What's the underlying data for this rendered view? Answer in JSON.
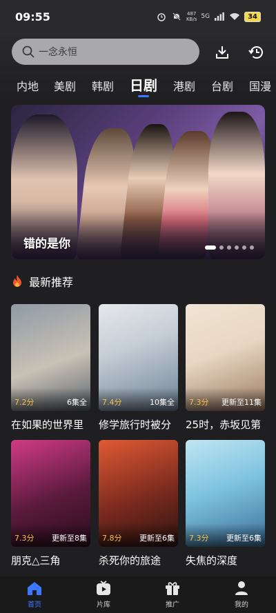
{
  "status": {
    "time": "09:55",
    "net_speed_top": "487",
    "net_speed_bottom": "KB/s",
    "signal": "5G",
    "battery": "34"
  },
  "search": {
    "placeholder": "一念永恒"
  },
  "tabs": [
    {
      "label": "内地"
    },
    {
      "label": "美剧"
    },
    {
      "label": "韩剧"
    },
    {
      "label": "日剧"
    },
    {
      "label": "港剧"
    },
    {
      "label": "台剧"
    },
    {
      "label": "国漫"
    }
  ],
  "banner": {
    "title": "错的是你"
  },
  "section": {
    "title": "最新推荐"
  },
  "cards": [
    {
      "title": "在如果的世界里",
      "score": "7.2分",
      "ep": "6集全",
      "c1": "#8f9aa6",
      "c2": "#c9c1b5"
    },
    {
      "title": "修学旅行时被分",
      "score": "7.4分",
      "ep": "10集全",
      "c1": "#c5cdd6",
      "c2": "#6f8296"
    },
    {
      "title": "25时，赤坂见第",
      "score": "7.3分",
      "ep": "更新至11集",
      "c1": "#e8d7c2",
      "c2": "#9a7a63"
    },
    {
      "title": "朋克△三角",
      "score": "7.3分",
      "ep": "更新至8集",
      "c1": "#5a1a3d",
      "c2": "#d13b86"
    },
    {
      "title": "杀死你的旅途",
      "score": "7.8分",
      "ep": "更新至6集",
      "c1": "#7a2a1e",
      "c2": "#e05a34"
    },
    {
      "title": "失焦的深度",
      "score": "7.3分",
      "ep": "更新至6集",
      "c1": "#7fc3e0",
      "c2": "#3b6f99"
    }
  ],
  "nav": [
    {
      "label": "首页",
      "icon": "home-icon"
    },
    {
      "label": "片库",
      "icon": "video-library-icon"
    },
    {
      "label": "推广",
      "icon": "gift-icon"
    },
    {
      "label": "我的",
      "icon": "profile-icon"
    }
  ],
  "colors": {
    "accent": "#3b78ff",
    "score": "#f5c24a",
    "background": "#1f1f21"
  }
}
